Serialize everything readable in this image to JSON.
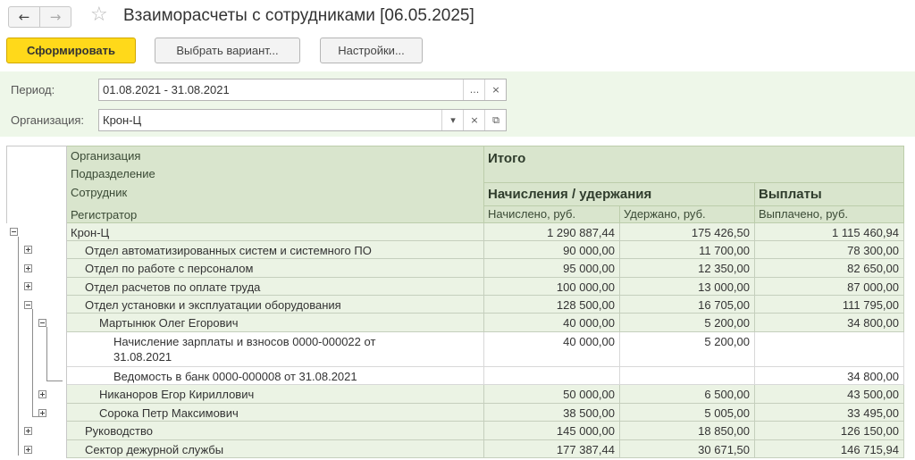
{
  "window": {
    "title": "Взаиморасчеты с сотрудниками [06.05.2025]",
    "back_icon": "←",
    "forward_icon": "→",
    "star_icon": "☆"
  },
  "toolbar": {
    "generate_label": "Сформировать",
    "variant_label": "Выбрать вариант...",
    "settings_label": "Настройки..."
  },
  "filters": {
    "period_label": "Период:",
    "period_value": "01.08.2021 - 31.08.2021",
    "period_select_icon": "...",
    "clear_icon": "×",
    "org_label": "Организация:",
    "org_value": "Крон-Ц",
    "dropdown_icon": "▾",
    "open_icon": "⧉"
  },
  "table": {
    "headers": {
      "organization": "Организация",
      "department": "Подразделение",
      "employee": "Сотрудник",
      "registrar": "Регистратор",
      "total": "Итого",
      "accruals_group": "Начисления / удержания",
      "payments_group": "Выплаты",
      "accrued": "Начислено, руб.",
      "withheld": "Удержано, руб.",
      "paid": "Выплачено, руб."
    },
    "rows": [
      {
        "name": "Крон-Ц",
        "accrued": "1 290 887,44",
        "withheld": "175 426,50",
        "paid": "1 115 460,94"
      },
      {
        "name": "Отдел автоматизированных систем и системного ПО",
        "accrued": "90 000,00",
        "withheld": "11 700,00",
        "paid": "78 300,00"
      },
      {
        "name": "Отдел по работе с персоналом",
        "accrued": "95 000,00",
        "withheld": "12 350,00",
        "paid": "82 650,00"
      },
      {
        "name": "Отдел расчетов по оплате труда",
        "accrued": "100 000,00",
        "withheld": "13 000,00",
        "paid": "87 000,00"
      },
      {
        "name": "Отдел установки и эксплуатации оборудования",
        "accrued": "128 500,00",
        "withheld": "16 705,00",
        "paid": "111 795,00"
      },
      {
        "name": "Мартынюк Олег Егорович",
        "accrued": "40 000,00",
        "withheld": "5 200,00",
        "paid": "34 800,00"
      },
      {
        "name": "Начисление зарплаты и взносов 0000-000022 от 31.08.2021",
        "accrued": "40 000,00",
        "withheld": "5 200,00",
        "paid": ""
      },
      {
        "name": "Ведомость в банк 0000-000008 от 31.08.2021",
        "accrued": "",
        "withheld": "",
        "paid": "34 800,00"
      },
      {
        "name": "Никаноров Егор Кириллович",
        "accrued": "50 000,00",
        "withheld": "6 500,00",
        "paid": "43 500,00"
      },
      {
        "name": "Сорока Петр Максимович",
        "accrued": "38 500,00",
        "withheld": "5 005,00",
        "paid": "33 495,00"
      },
      {
        "name": "Руководство",
        "accrued": "145 000,00",
        "withheld": "18 850,00",
        "paid": "126 150,00"
      },
      {
        "name": "Сектор дежурной службы",
        "accrued": "177 387,44",
        "withheld": "30 671,50",
        "paid": "146 715,94"
      }
    ]
  },
  "colors": {
    "primary_button": "#ffd91a",
    "header_bg": "#d9e5cd",
    "group_row_bg": "#ebf3e4",
    "filter_panel_bg": "#eef7e9"
  }
}
